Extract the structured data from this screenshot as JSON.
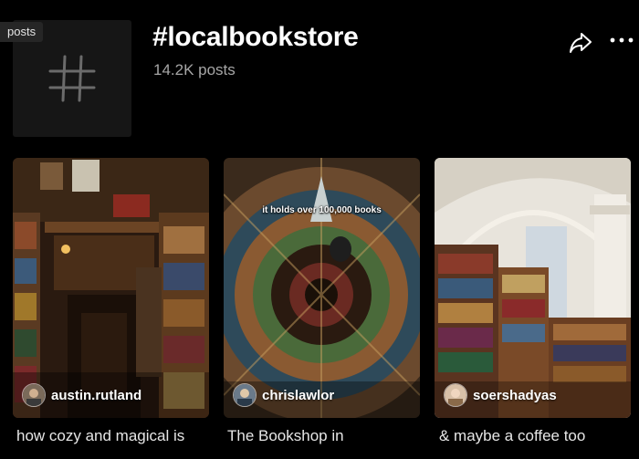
{
  "header": {
    "badge": "posts",
    "hashtag": "#localbookstore",
    "post_count": "14.2K posts",
    "icons": {
      "share": "share-arrow-icon",
      "more": "more-dots-icon"
    }
  },
  "posts": [
    {
      "username": "austin.rutland",
      "caption": "how cozy and magical is",
      "overlay": ""
    },
    {
      "username": "chrislawlor",
      "caption": "The Bookshop in",
      "overlay": "it holds over 100,000 books"
    },
    {
      "username": "soershadyas",
      "caption": "& maybe a coffee too",
      "overlay": ""
    }
  ]
}
